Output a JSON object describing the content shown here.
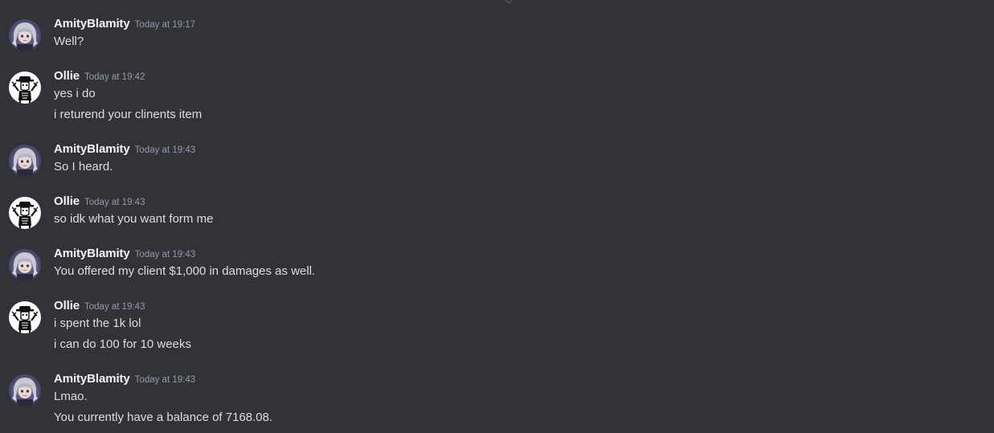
{
  "messages": [
    {
      "author": "AmityBlamity",
      "avatar": "amity-avatar-icon",
      "timestamp": "Today at 19:17",
      "lines": [
        "Well?"
      ]
    },
    {
      "author": "Ollie",
      "avatar": "ollie-avatar-icon",
      "timestamp": "Today at 19:42",
      "lines": [
        "yes i do",
        "i returend your clinents item"
      ]
    },
    {
      "author": "AmityBlamity",
      "avatar": "amity-avatar-icon",
      "timestamp": "Today at 19:43",
      "lines": [
        "So I heard."
      ]
    },
    {
      "author": "Ollie",
      "avatar": "ollie-avatar-icon",
      "timestamp": "Today at 19:43",
      "lines": [
        "so idk what you want form me"
      ]
    },
    {
      "author": "AmityBlamity",
      "avatar": "amity-avatar-icon",
      "timestamp": "Today at 19:43",
      "lines": [
        "You offered my client $1,000 in damages as well."
      ]
    },
    {
      "author": "Ollie",
      "avatar": "ollie-avatar-icon",
      "timestamp": "Today at 19:43",
      "lines": [
        "i spent the 1k lol",
        "i can do 100 for 10 weeks"
      ]
    },
    {
      "author": "AmityBlamity",
      "avatar": "amity-avatar-icon",
      "timestamp": "Today at 19:43",
      "lines": [
        "Lmao.",
        "You currently have a balance of 7168.08."
      ]
    }
  ],
  "colors": {
    "background": "#313338",
    "username": "#f2f3f5",
    "message_text": "#dbdee1",
    "timestamp": "#949ba4"
  }
}
